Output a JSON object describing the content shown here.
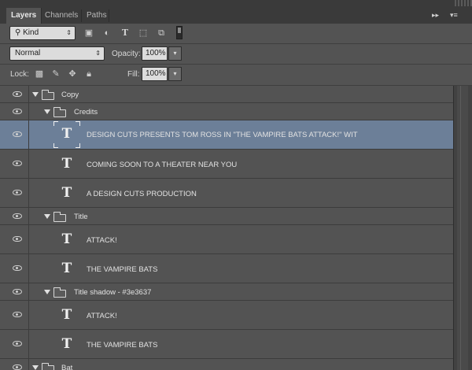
{
  "tabs": [
    {
      "label": "Layers"
    },
    {
      "label": "Channels"
    },
    {
      "label": "Paths"
    }
  ],
  "panel_controls": {
    "collapse_glyph": "▸▸",
    "menu_glyph": "▾≡"
  },
  "filter": {
    "kind_label": "Kind",
    "icons": [
      "image-filter-icon",
      "adjustment-filter-icon",
      "type-filter-icon",
      "shape-filter-icon",
      "smart-object-filter-icon",
      "filter-toggle-switch"
    ]
  },
  "blend": {
    "mode": "Normal",
    "opacity_label": "Opacity:",
    "opacity_value": "100%",
    "lock_label": "Lock:",
    "fill_label": "Fill:",
    "fill_value": "100%"
  },
  "layers": [
    {
      "type": "group",
      "name": "Copy",
      "depth": 0,
      "visible": true
    },
    {
      "type": "group",
      "name": "Credits",
      "depth": 1,
      "visible": true
    },
    {
      "type": "text",
      "name": "DESIGN CUTS PRESENTS TOM ROSS IN \"THE VAMPIRE BATS ATTACK!\" WIT",
      "depth": 2,
      "visible": true,
      "selected": true
    },
    {
      "type": "text",
      "name": "COMING SOON TO A THEATER NEAR YOU",
      "depth": 2,
      "visible": true
    },
    {
      "type": "text",
      "name": "A DESIGN CUTS PRODUCTION",
      "depth": 2,
      "visible": true
    },
    {
      "type": "group",
      "name": "Title",
      "depth": 1,
      "visible": true
    },
    {
      "type": "text",
      "name": "ATTACK!",
      "depth": 2,
      "visible": true
    },
    {
      "type": "text",
      "name": "THE VAMPIRE BATS",
      "depth": 2,
      "visible": true
    },
    {
      "type": "group",
      "name": "Title shadow - #3e3637",
      "depth": 1,
      "visible": true
    },
    {
      "type": "text",
      "name": "ATTACK!",
      "depth": 2,
      "visible": true
    },
    {
      "type": "text",
      "name": "THE VAMPIRE BATS",
      "depth": 2,
      "visible": true
    },
    {
      "type": "group",
      "name": "Bat",
      "depth": 0,
      "visible": true
    }
  ],
  "type_glyph": "T",
  "colors": {
    "panel": "#535353",
    "selected_row": "#6c7f98",
    "tab_strip": "#3a3a3a"
  }
}
